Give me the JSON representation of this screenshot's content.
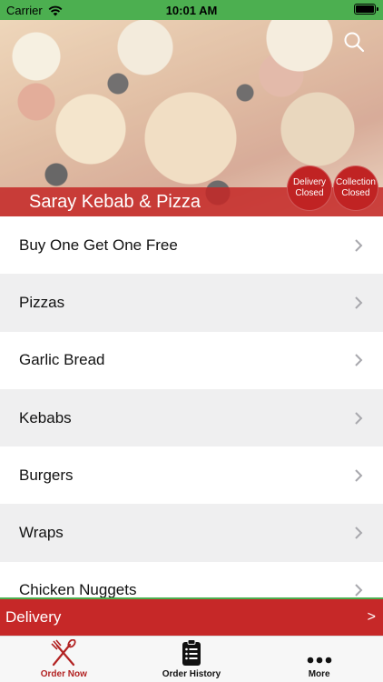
{
  "status_bar": {
    "carrier": "Carrier",
    "time": "10:01 AM",
    "battery_level": 1.0
  },
  "hero": {
    "restaurant_name": "Saray Kebab & Pizza",
    "search_icon": "search-icon",
    "delivery_badge": {
      "line1": "Delivery",
      "line2": "Closed"
    },
    "collection_badge": {
      "line1": "Collection",
      "line2": "Closed"
    }
  },
  "menu": {
    "items": [
      {
        "label": "Buy One Get One Free"
      },
      {
        "label": "Pizzas"
      },
      {
        "label": "Garlic Bread"
      },
      {
        "label": "Kebabs"
      },
      {
        "label": "Burgers"
      },
      {
        "label": "Wraps"
      },
      {
        "label": "Chicken Nuggets"
      }
    ]
  },
  "delivery_bar": {
    "label": "Delivery",
    "arrow": ">"
  },
  "tab_bar": {
    "tabs": [
      {
        "label": "Order Now",
        "icon": "fork-knife-icon",
        "active": true
      },
      {
        "label": "Order History",
        "icon": "clipboard-list-icon",
        "active": false
      },
      {
        "label": "More",
        "icon": "more-dots-icon",
        "active": false
      }
    ]
  },
  "colors": {
    "status_green": "#4caf50",
    "brand_red": "#c62828",
    "active_tab": "#b22222"
  }
}
